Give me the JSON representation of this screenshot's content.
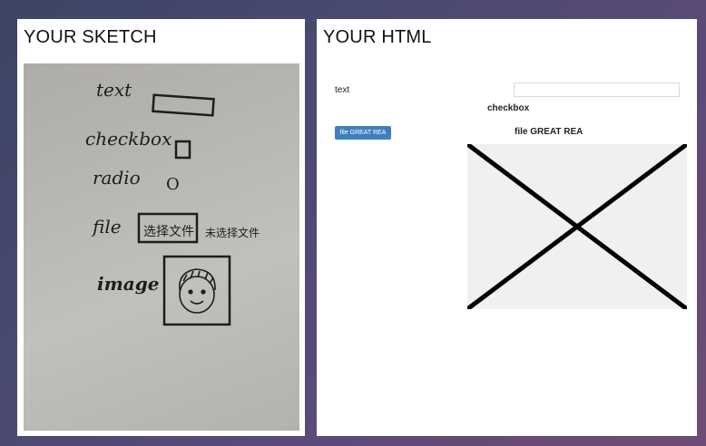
{
  "left_panel": {
    "title": "YOUR SKETCH",
    "sketch": {
      "text_label": "text",
      "checkbox_label": "checkbox",
      "radio_label": "radio",
      "file_label": "file",
      "file_button": "选择文件",
      "file_status": "未选择文件",
      "image_label": "image",
      "radio_glyph": "O"
    }
  },
  "right_panel": {
    "title": "YOUR HTML",
    "form": {
      "text_label": "text",
      "text_input_value": "",
      "checkbox_label": "checkbox",
      "file_button_label": "file GREAT REA",
      "file_label": "file GREAT REA"
    }
  },
  "colors": {
    "button_blue": "#3f7fc0",
    "placeholder_gray": "#f0f0f0"
  }
}
